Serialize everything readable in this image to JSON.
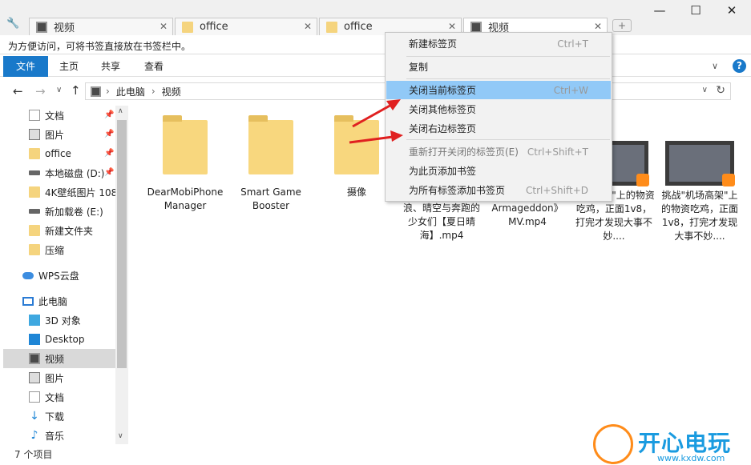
{
  "tabs": [
    {
      "label": "视频",
      "icon": "video-icon"
    },
    {
      "label": "office",
      "icon": "folder-icon"
    },
    {
      "label": "office",
      "icon": "folder-icon"
    },
    {
      "label": "视频",
      "icon": "video-icon"
    }
  ],
  "window": {
    "minimize": "—",
    "maximize": "☐",
    "close": "✕",
    "new_tab": "+",
    "tools": "🔧"
  },
  "bookmark_bar": {
    "hint": "为方便访问，可将书签直接放在书签栏中。"
  },
  "ribbon": {
    "tabs": [
      "文件",
      "主页",
      "共享",
      "查看"
    ],
    "help": "?",
    "expand": "∨"
  },
  "address": {
    "back": "←",
    "forward": "→",
    "recent": "∨",
    "up": "↑",
    "path": [
      "此电脑",
      "视频"
    ],
    "sep": "›",
    "dropdown": "∨",
    "refresh": "↻"
  },
  "nav": {
    "items": [
      {
        "label": "文档",
        "pinned": true,
        "icon": "document-icon"
      },
      {
        "label": "图片",
        "pinned": true,
        "icon": "picture-icon"
      },
      {
        "label": "office",
        "pinned": true,
        "icon": "folder-icon"
      },
      {
        "label": "本地磁盘 (D:)",
        "pinned": true,
        "icon": "drive-icon"
      },
      {
        "label": "4K壁纸图片 108",
        "pinned": false,
        "icon": "folder-icon"
      },
      {
        "label": "新加载卷 (E:)",
        "pinned": false,
        "icon": "drive-icon"
      },
      {
        "label": "新建文件夹",
        "pinned": false,
        "icon": "folder-icon"
      },
      {
        "label": "压缩",
        "pinned": false,
        "icon": "folder-icon"
      },
      {
        "label": "WPS云盘",
        "pinned": false,
        "icon": "cloud-icon"
      },
      {
        "label": "此电脑",
        "pinned": false,
        "icon": "computer-icon"
      },
      {
        "label": "3D 对象",
        "pinned": false,
        "icon": "cube-icon"
      },
      {
        "label": "Desktop",
        "pinned": false,
        "icon": "desktop-icon"
      },
      {
        "label": "视频",
        "pinned": false,
        "icon": "video-icon"
      },
      {
        "label": "图片",
        "pinned": false,
        "icon": "picture-icon"
      },
      {
        "label": "文档",
        "pinned": false,
        "icon": "document-icon"
      },
      {
        "label": "下载",
        "pinned": false,
        "icon": "download-icon"
      },
      {
        "label": "音乐",
        "pinned": false,
        "icon": "music-icon"
      }
    ],
    "pin": "📌",
    "scroll_up": "∧",
    "scroll_down": "∨"
  },
  "files": [
    {
      "name": "DearMobiPhoneManager",
      "type": "folder"
    },
    {
      "name": "Smart Game Booster",
      "type": "folder"
    },
    {
      "name": "摄像",
      "type": "folder"
    },
    {
      "name": "浪、晴空与奔跑的少女们【夏日晴海】.mp4",
      "type": "video"
    },
    {
      "name": "Armageddon》MV.mp4",
      "type": "video"
    },
    {
      "name": "机场高架\"上的物资吃鸡，正面1v8，打完才发现大事不妙....",
      "type": "video"
    },
    {
      "name": "挑战\"机场高架\"上的物资吃鸡，正面1v8，打完才发现大事不妙....",
      "type": "video"
    }
  ],
  "status": {
    "count": "7 个项目"
  },
  "menu": [
    {
      "label": "新建标签页",
      "shortcut": "Ctrl+T",
      "state": "normal"
    },
    {
      "label": "复制",
      "shortcut": "",
      "state": "normal"
    },
    {
      "label": "关闭当前标签页",
      "shortcut": "Ctrl+W",
      "state": "highlight"
    },
    {
      "label": "关闭其他标签页",
      "shortcut": "",
      "state": "normal"
    },
    {
      "label": "关闭右边标签页",
      "shortcut": "",
      "state": "normal"
    },
    {
      "label": "重新打开关闭的标签页(E)",
      "shortcut": "Ctrl+Shift+T",
      "state": "disabled"
    },
    {
      "label": "为此页添加书签",
      "shortcut": "",
      "state": "normal"
    },
    {
      "label": "为所有标签添加书签页",
      "shortcut": "Ctrl+Shift+D",
      "state": "normal"
    }
  ],
  "watermark": {
    "brand": "开心电玩",
    "url": "www.kxdw.com"
  },
  "colors": {
    "accent": "#1979ca",
    "highlight": "#91c9f7",
    "arrow": "#e02020",
    "folder": "#f8d77e"
  }
}
